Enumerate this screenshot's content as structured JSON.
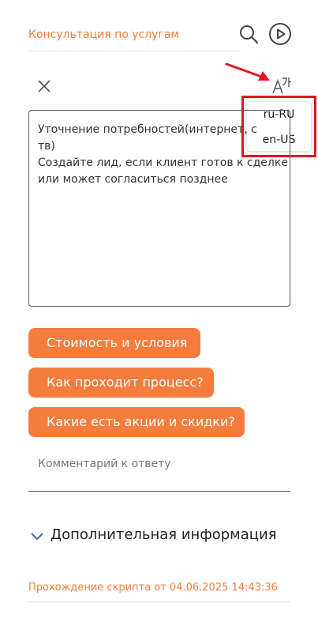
{
  "header": {
    "title": "Консультация по услугам",
    "search_icon": "search-icon",
    "play_icon": "play-icon"
  },
  "toolbar": {
    "close_icon": "close-icon",
    "translate_icon": "translate-icon"
  },
  "language_menu": {
    "items": [
      "ru-RU",
      "en-US"
    ]
  },
  "script_text": {
    "lines": [
      "Уточнение потребностей(интернет, с",
      "тв)",
      "Создайте лид, если клиент готов к сделке",
      "или может согласиться позднее"
    ]
  },
  "quick_replies": [
    "Стоимость и условия",
    "Как проходит процесс?",
    "Какие есть акции и скидки?"
  ],
  "comment": {
    "placeholder": "Комментарий к ответу"
  },
  "extra_info": {
    "label": "Дополнительная информация"
  },
  "script_run": {
    "text": "Прохождение скрипта от 04.06.2025 14:43:36"
  },
  "colors": {
    "accent": "#f47c3c",
    "highlight": "#e2161c"
  }
}
